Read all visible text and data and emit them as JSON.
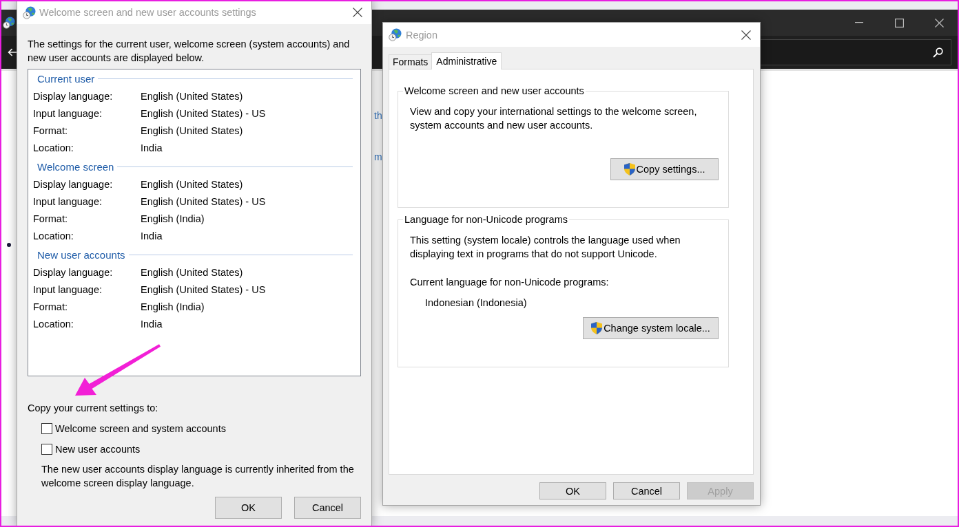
{
  "background_window": {
    "link_fragments": [
      "th",
      "m"
    ]
  },
  "region_dialog": {
    "title": "Region",
    "active": false,
    "tabs": [
      {
        "label": "Formats",
        "selected": false
      },
      {
        "label": "Administrative",
        "selected": true
      }
    ],
    "groups": [
      {
        "title": "Welcome screen and new user accounts",
        "description": "View and copy your international settings to the welcome screen, system accounts and new user accounts.",
        "button": {
          "label": "Copy settings...",
          "shield": true
        }
      },
      {
        "title": "Language for non-Unicode programs",
        "description": "This setting (system locale) controls the language used when displaying text in programs that do not support Unicode.",
        "current_label": "Current language for non-Unicode programs:",
        "current_value": "Indonesian (Indonesia)",
        "button": {
          "label": "Change system locale...",
          "shield": true
        }
      }
    ],
    "buttons": [
      {
        "label": "OK",
        "disabled": false
      },
      {
        "label": "Cancel",
        "disabled": false
      },
      {
        "label": "Apply",
        "disabled": true
      }
    ]
  },
  "welcome_dialog": {
    "title": "Welcome screen and new user accounts settings",
    "active": false,
    "intro": "The settings for the current user, welcome screen (system accounts) and new user accounts are displayed below.",
    "sections": [
      {
        "heading": "Current user",
        "rows": [
          {
            "label": "Display language:",
            "value": "English (United States)"
          },
          {
            "label": "Input language:",
            "value": "English (United States) - US"
          },
          {
            "label": "Format:",
            "value": "English (United States)"
          },
          {
            "label": "Location:",
            "value": "India"
          }
        ]
      },
      {
        "heading": "Welcome screen",
        "rows": [
          {
            "label": "Display language:",
            "value": "English (United States)"
          },
          {
            "label": "Input language:",
            "value": "English (United States) - US"
          },
          {
            "label": "Format:",
            "value": "English (India)"
          },
          {
            "label": "Location:",
            "value": "India"
          }
        ]
      },
      {
        "heading": "New user accounts",
        "rows": [
          {
            "label": "Display language:",
            "value": "English (United States)"
          },
          {
            "label": "Input language:",
            "value": "English (United States) - US"
          },
          {
            "label": "Format:",
            "value": "English (India)"
          },
          {
            "label": "Location:",
            "value": "India"
          }
        ]
      }
    ],
    "copy_label": "Copy your current settings to:",
    "checkboxes": [
      {
        "label": "Welcome screen and system accounts",
        "checked": false
      },
      {
        "label": "New user accounts",
        "checked": false
      }
    ],
    "note": "The new user accounts display language is currently inherited from the welcome screen display language.",
    "buttons": [
      {
        "label": "OK",
        "disabled": false
      },
      {
        "label": "Cancel",
        "disabled": false
      }
    ]
  }
}
